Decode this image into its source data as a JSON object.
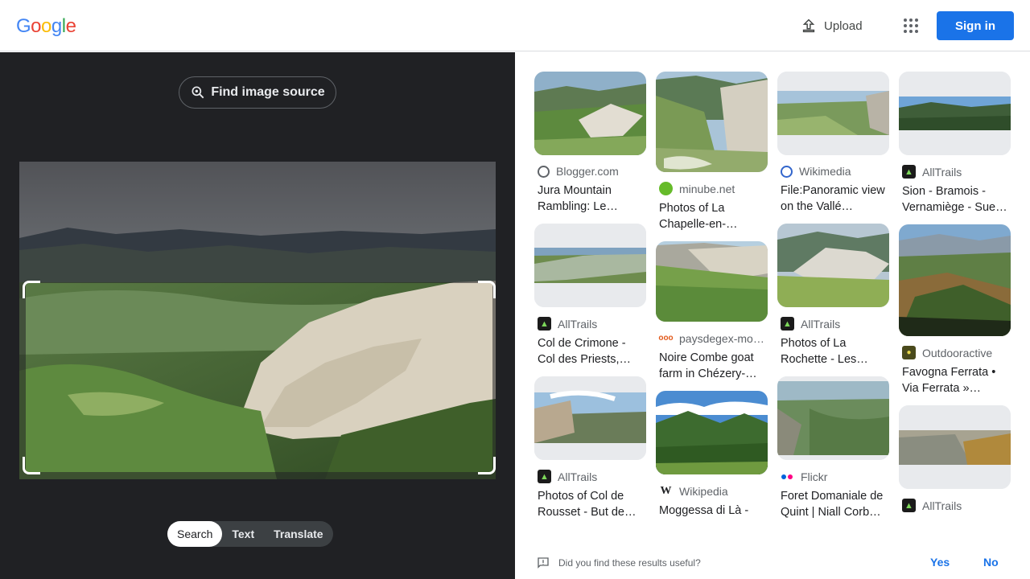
{
  "header": {
    "logo_text": "Google",
    "upload_label": "Upload",
    "apps_icon": "apps-grid-icon",
    "signin_label": "Sign in",
    "accent_color": "#1a73e8"
  },
  "left_panel": {
    "find_source_label": "Find image source",
    "mode_tabs": [
      {
        "label": "Search",
        "active": true
      },
      {
        "label": "Text",
        "active": false
      },
      {
        "label": "Translate",
        "active": false
      }
    ]
  },
  "results": {
    "columns": [
      [
        {
          "source": "Blogger.com",
          "favicon": "globe-icon",
          "title": "Jura Mountain Rambling: Le…"
        },
        {
          "source": "AllTrails",
          "favicon": "alltrails-icon",
          "title": "Col de Crimone - Col des Priests,…"
        },
        {
          "source": "AllTrails",
          "favicon": "alltrails-icon",
          "title": "Photos of Col de Rousset - But de…"
        }
      ],
      [
        {
          "source": "minube.net",
          "favicon": "minube-icon",
          "title": "Photos of La Chapelle-en-…"
        },
        {
          "source": "paysdegex-mo…",
          "favicon": "paysdegex-icon",
          "title": "Noire Combe goat farm in Chézery-…"
        },
        {
          "source": "Wikipedia",
          "favicon": "wikipedia-icon",
          "title": "Moggessa di Là -"
        }
      ],
      [
        {
          "source": "Wikimedia",
          "favicon": "wikimedia-icon",
          "title": "File:Panoramic view on the Vallé…"
        },
        {
          "source": "AllTrails",
          "favicon": "alltrails-icon",
          "title": "Photos of La Rochette - Les…"
        },
        {
          "source": "Flickr",
          "favicon": "flickr-icon",
          "title": "Foret Domaniale de Quint | Niall Corb…"
        }
      ],
      [
        {
          "source": "AllTrails",
          "favicon": "alltrails-icon",
          "title": "Sion - Bramois - Vernamiège - Sue…"
        },
        {
          "source": "Outdooractive",
          "favicon": "outdooractive-icon",
          "title": "Favogna Ferrata • Via Ferrata »…"
        },
        {
          "source": "AllTrails",
          "favicon": "alltrails-icon",
          "title": ""
        }
      ]
    ]
  },
  "feedback": {
    "question": "Did you find these results useful?",
    "yes_label": "Yes",
    "no_label": "No"
  }
}
